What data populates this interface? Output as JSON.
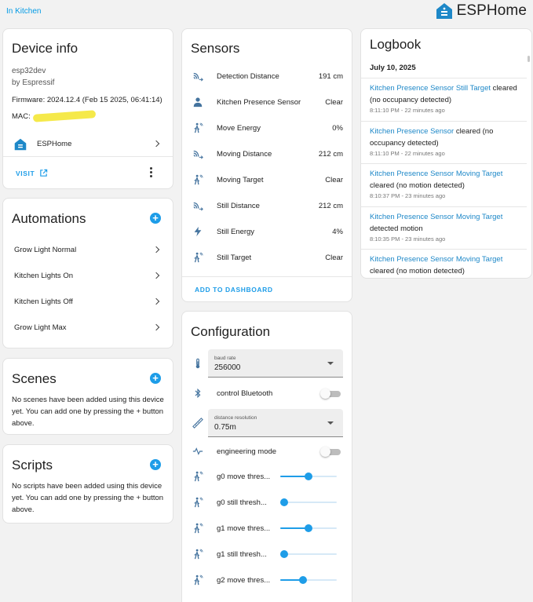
{
  "breadcrumb": "In Kitchen",
  "brand": {
    "name": "ESPHome",
    "color": "#1e88c8"
  },
  "device_info": {
    "title": "Device info",
    "model": "esp32dev",
    "manufacturer": "by Espressif",
    "firmware": "Firmware: 2024.12.4 (Feb 15 2025, 06:41:14)",
    "mac_label": "MAC:",
    "integration": "ESPHome",
    "visit_label": "VISIT"
  },
  "automations": {
    "title": "Automations",
    "items": [
      "Grow Light Normal",
      "Kitchen Lights On",
      "Kitchen Lights Off",
      "Grow Light Max"
    ]
  },
  "scenes": {
    "title": "Scenes",
    "empty_text": "No scenes have been added using this device yet. You can add one by pressing the + button above."
  },
  "scripts": {
    "title": "Scripts",
    "empty_text": "No scripts have been added using this device yet. You can add one by pressing the + button above."
  },
  "sensors": {
    "title": "Sensors",
    "add_label": "ADD TO DASHBOARD",
    "rows": [
      {
        "icon": "signal-distance-icon",
        "name": "Detection Distance",
        "value": "191 cm"
      },
      {
        "icon": "person-icon",
        "name": "Kitchen Presence Sensor",
        "value": "Clear"
      },
      {
        "icon": "walking-motion-icon",
        "name": "Move Energy",
        "value": "0%"
      },
      {
        "icon": "signal-distance-icon",
        "name": "Moving Distance",
        "value": "212 cm"
      },
      {
        "icon": "walking-motion-icon",
        "name": "Moving Target",
        "value": "Clear"
      },
      {
        "icon": "signal-distance-icon",
        "name": "Still Distance",
        "value": "212 cm"
      },
      {
        "icon": "lightning-icon",
        "name": "Still Energy",
        "value": "4%"
      },
      {
        "icon": "walking-motion-icon",
        "name": "Still Target",
        "value": "Clear"
      }
    ]
  },
  "configuration": {
    "title": "Configuration",
    "baud_rate": {
      "label": "baud rate",
      "value": "256000"
    },
    "bluetooth": {
      "label": "control Bluetooth",
      "on": false
    },
    "distance_resolution": {
      "label": "distance resolution",
      "value": "0.75m"
    },
    "engineering_mode": {
      "label": "engineering mode",
      "on": false
    },
    "sliders": [
      {
        "label": "g0 move thres...",
        "level": 0.5
      },
      {
        "label": "g0 still thresh...",
        "level": 0.0
      },
      {
        "label": "g1 move thres...",
        "level": 0.5
      },
      {
        "label": "g1 still thresh...",
        "level": 0.0
      },
      {
        "label": "g2 move thres...",
        "level": 0.4
      }
    ]
  },
  "logbook": {
    "title": "Logbook",
    "date": "July 10, 2025",
    "entries": [
      {
        "entity": "Kitchen Presence Sensor Still Target",
        "message": "cleared (no occupancy detected)",
        "time": "8:11:10 PM - 22 minutes ago"
      },
      {
        "entity": "Kitchen Presence Sensor",
        "message": "cleared (no occupancy detected)",
        "time": "8:11:10 PM - 22 minutes ago"
      },
      {
        "entity": "Kitchen Presence Sensor Moving Target",
        "message": "cleared (no motion detected)",
        "time": "8:10:37 PM - 23 minutes ago"
      },
      {
        "entity": "Kitchen Presence Sensor Moving Target",
        "message": "detected motion",
        "time": "8:10:35 PM - 23 minutes ago"
      },
      {
        "entity": "Kitchen Presence Sensor Moving Target",
        "message": "cleared (no motion detected)",
        "time": ""
      }
    ]
  }
}
